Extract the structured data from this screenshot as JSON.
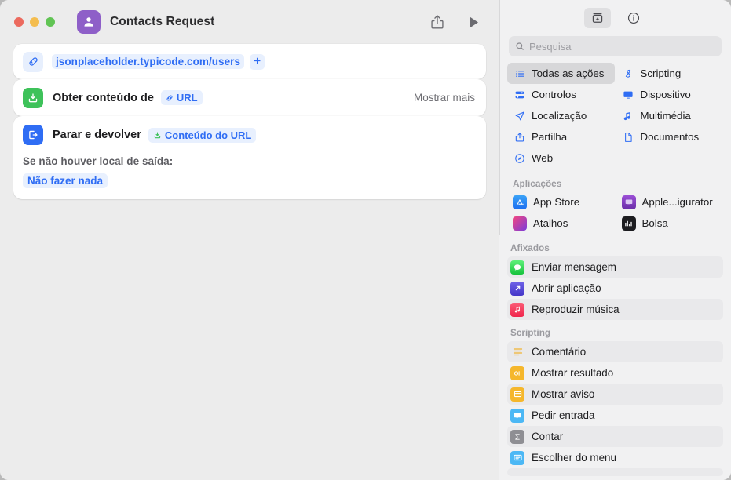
{
  "window": {
    "title": "Contacts Request",
    "app_icon": "contact-person-icon",
    "traffic_lights": [
      "close",
      "minimize",
      "maximize"
    ],
    "toolbar": {
      "share_label": "share-icon",
      "run_label": "play-icon"
    }
  },
  "workflow": {
    "steps": [
      {
        "type": "url",
        "icon": "link-icon",
        "url": "jsonplaceholder.typicode.com/users",
        "add_label": "+"
      },
      {
        "type": "action",
        "icon": "download-box-icon",
        "label": "Obter conteúdo de",
        "token": "URL",
        "token_icon": "link-icon",
        "trailing": "Mostrar mais"
      },
      {
        "type": "action",
        "icon": "exit-door-icon",
        "label": "Parar e devolver",
        "token": "Conteúdo do URL",
        "token_icon": "download-box-icon",
        "sub_label": "Se não houver local de saída:",
        "sub_value": "Não fazer nada"
      }
    ]
  },
  "library": {
    "toolbar": {
      "actions_button": "add-action-icon",
      "info_button": "info-icon"
    },
    "search": {
      "placeholder": "Pesquisa",
      "value": "",
      "icon": "search-icon"
    },
    "categories": [
      {
        "label": "Todas as ações",
        "icon": "list-bullet-icon",
        "selected": true
      },
      {
        "label": "Scripting",
        "icon": "script-icon",
        "selected": false
      },
      {
        "label": "Controlos",
        "icon": "sliders-icon",
        "selected": false
      },
      {
        "label": "Dispositivo",
        "icon": "display-icon",
        "selected": false
      },
      {
        "label": "Localização",
        "icon": "location-arrow-icon",
        "selected": false
      },
      {
        "label": "Multimédia",
        "icon": "music-note-icon",
        "selected": false
      },
      {
        "label": "Partilha",
        "icon": "share-icon",
        "selected": false
      },
      {
        "label": "Documentos",
        "icon": "document-icon",
        "selected": false
      },
      {
        "label": "Web",
        "icon": "safari-compass-icon",
        "selected": false
      }
    ],
    "apps_header": "Aplicações",
    "apps": [
      {
        "label": "App Store",
        "icon": "app-store-icon"
      },
      {
        "label": "Apple...igurator",
        "icon": "apple-configurator-icon"
      },
      {
        "label": "Atalhos",
        "icon": "shortcuts-icon"
      },
      {
        "label": "Bolsa",
        "icon": "stocks-icon"
      }
    ],
    "pinned_header": "Afixados",
    "pinned": [
      {
        "label": "Enviar mensagem",
        "icon": "messages-icon"
      },
      {
        "label": "Abrir aplicação",
        "icon": "open-app-icon"
      },
      {
        "label": "Reproduzir música",
        "icon": "music-icon"
      }
    ],
    "scripting_header": "Scripting",
    "scripting": [
      {
        "label": "Comentário",
        "icon": "comment-lines-icon"
      },
      {
        "label": "Mostrar resultado",
        "icon": "show-result-icon"
      },
      {
        "label": "Mostrar aviso",
        "icon": "show-alert-icon"
      },
      {
        "label": "Pedir entrada",
        "icon": "ask-input-icon"
      },
      {
        "label": "Contar",
        "icon": "count-sigma-icon"
      },
      {
        "label": "Escolher do menu",
        "icon": "choose-menu-icon"
      }
    ]
  },
  "colors": {
    "accent_blue": "#2f6df4",
    "green": "#3ec25a",
    "purple": "#8e5fc8",
    "window_bg": "#ececec",
    "sidebar_bg": "#f1f1f2"
  }
}
